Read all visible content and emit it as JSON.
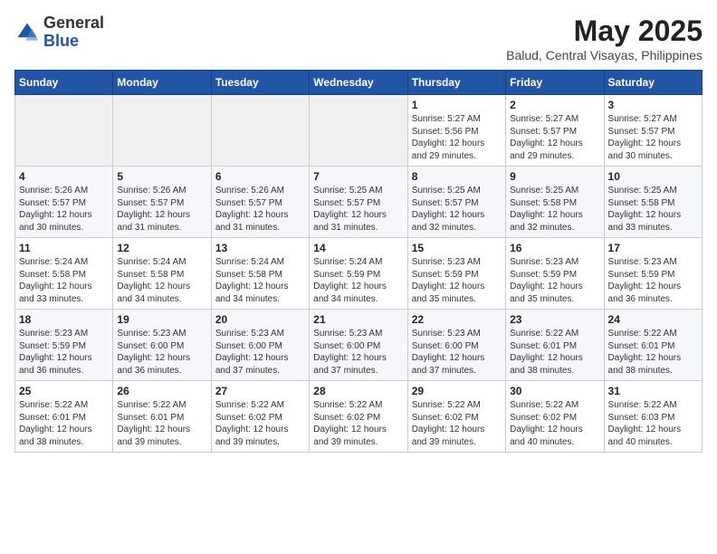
{
  "header": {
    "logo_general": "General",
    "logo_blue": "Blue",
    "month_year": "May 2025",
    "location": "Balud, Central Visayas, Philippines"
  },
  "weekdays": [
    "Sunday",
    "Monday",
    "Tuesday",
    "Wednesday",
    "Thursday",
    "Friday",
    "Saturday"
  ],
  "weeks": [
    [
      {
        "day": "",
        "info": ""
      },
      {
        "day": "",
        "info": ""
      },
      {
        "day": "",
        "info": ""
      },
      {
        "day": "",
        "info": ""
      },
      {
        "day": "1",
        "info": "Sunrise: 5:27 AM\nSunset: 5:56 PM\nDaylight: 12 hours\nand 29 minutes."
      },
      {
        "day": "2",
        "info": "Sunrise: 5:27 AM\nSunset: 5:57 PM\nDaylight: 12 hours\nand 29 minutes."
      },
      {
        "day": "3",
        "info": "Sunrise: 5:27 AM\nSunset: 5:57 PM\nDaylight: 12 hours\nand 30 minutes."
      }
    ],
    [
      {
        "day": "4",
        "info": "Sunrise: 5:26 AM\nSunset: 5:57 PM\nDaylight: 12 hours\nand 30 minutes."
      },
      {
        "day": "5",
        "info": "Sunrise: 5:26 AM\nSunset: 5:57 PM\nDaylight: 12 hours\nand 31 minutes."
      },
      {
        "day": "6",
        "info": "Sunrise: 5:26 AM\nSunset: 5:57 PM\nDaylight: 12 hours\nand 31 minutes."
      },
      {
        "day": "7",
        "info": "Sunrise: 5:25 AM\nSunset: 5:57 PM\nDaylight: 12 hours\nand 31 minutes."
      },
      {
        "day": "8",
        "info": "Sunrise: 5:25 AM\nSunset: 5:57 PM\nDaylight: 12 hours\nand 32 minutes."
      },
      {
        "day": "9",
        "info": "Sunrise: 5:25 AM\nSunset: 5:58 PM\nDaylight: 12 hours\nand 32 minutes."
      },
      {
        "day": "10",
        "info": "Sunrise: 5:25 AM\nSunset: 5:58 PM\nDaylight: 12 hours\nand 33 minutes."
      }
    ],
    [
      {
        "day": "11",
        "info": "Sunrise: 5:24 AM\nSunset: 5:58 PM\nDaylight: 12 hours\nand 33 minutes."
      },
      {
        "day": "12",
        "info": "Sunrise: 5:24 AM\nSunset: 5:58 PM\nDaylight: 12 hours\nand 34 minutes."
      },
      {
        "day": "13",
        "info": "Sunrise: 5:24 AM\nSunset: 5:58 PM\nDaylight: 12 hours\nand 34 minutes."
      },
      {
        "day": "14",
        "info": "Sunrise: 5:24 AM\nSunset: 5:59 PM\nDaylight: 12 hours\nand 34 minutes."
      },
      {
        "day": "15",
        "info": "Sunrise: 5:23 AM\nSunset: 5:59 PM\nDaylight: 12 hours\nand 35 minutes."
      },
      {
        "day": "16",
        "info": "Sunrise: 5:23 AM\nSunset: 5:59 PM\nDaylight: 12 hours\nand 35 minutes."
      },
      {
        "day": "17",
        "info": "Sunrise: 5:23 AM\nSunset: 5:59 PM\nDaylight: 12 hours\nand 36 minutes."
      }
    ],
    [
      {
        "day": "18",
        "info": "Sunrise: 5:23 AM\nSunset: 5:59 PM\nDaylight: 12 hours\nand 36 minutes."
      },
      {
        "day": "19",
        "info": "Sunrise: 5:23 AM\nSunset: 6:00 PM\nDaylight: 12 hours\nand 36 minutes."
      },
      {
        "day": "20",
        "info": "Sunrise: 5:23 AM\nSunset: 6:00 PM\nDaylight: 12 hours\nand 37 minutes."
      },
      {
        "day": "21",
        "info": "Sunrise: 5:23 AM\nSunset: 6:00 PM\nDaylight: 12 hours\nand 37 minutes."
      },
      {
        "day": "22",
        "info": "Sunrise: 5:23 AM\nSunset: 6:00 PM\nDaylight: 12 hours\nand 37 minutes."
      },
      {
        "day": "23",
        "info": "Sunrise: 5:22 AM\nSunset: 6:01 PM\nDaylight: 12 hours\nand 38 minutes."
      },
      {
        "day": "24",
        "info": "Sunrise: 5:22 AM\nSunset: 6:01 PM\nDaylight: 12 hours\nand 38 minutes."
      }
    ],
    [
      {
        "day": "25",
        "info": "Sunrise: 5:22 AM\nSunset: 6:01 PM\nDaylight: 12 hours\nand 38 minutes."
      },
      {
        "day": "26",
        "info": "Sunrise: 5:22 AM\nSunset: 6:01 PM\nDaylight: 12 hours\nand 39 minutes."
      },
      {
        "day": "27",
        "info": "Sunrise: 5:22 AM\nSunset: 6:02 PM\nDaylight: 12 hours\nand 39 minutes."
      },
      {
        "day": "28",
        "info": "Sunrise: 5:22 AM\nSunset: 6:02 PM\nDaylight: 12 hours\nand 39 minutes."
      },
      {
        "day": "29",
        "info": "Sunrise: 5:22 AM\nSunset: 6:02 PM\nDaylight: 12 hours\nand 39 minutes."
      },
      {
        "day": "30",
        "info": "Sunrise: 5:22 AM\nSunset: 6:02 PM\nDaylight: 12 hours\nand 40 minutes."
      },
      {
        "day": "31",
        "info": "Sunrise: 5:22 AM\nSunset: 6:03 PM\nDaylight: 12 hours\nand 40 minutes."
      }
    ]
  ]
}
